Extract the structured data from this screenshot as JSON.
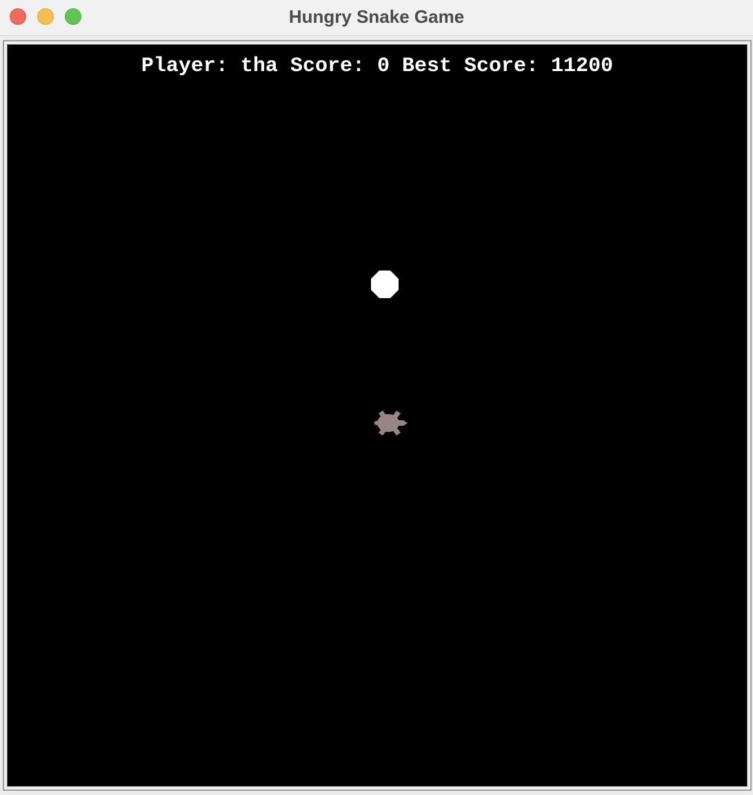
{
  "window": {
    "title": "Hungry Snake Game"
  },
  "hud": {
    "player_label": "Player:",
    "player_name": "tha",
    "score_label": "Score:",
    "score_value": "0",
    "best_label": "Best Score:",
    "best_value": "11200"
  },
  "game": {
    "background_color": "#000000",
    "food_color": "#ffffff",
    "snake_color": "#998585",
    "food_icon": "food-dot-icon",
    "snake_icon": "turtle-icon"
  }
}
